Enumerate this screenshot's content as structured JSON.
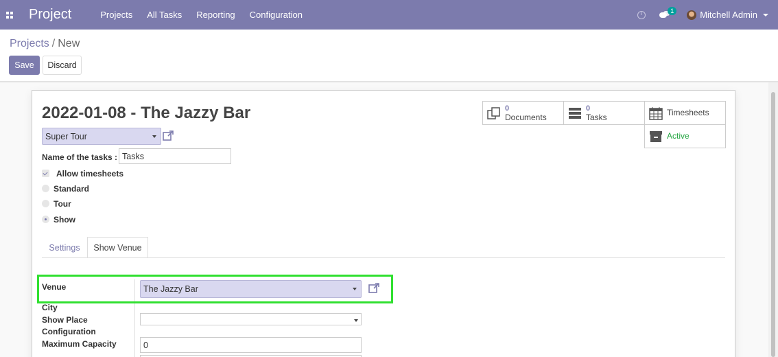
{
  "navbar": {
    "app_name": "Project",
    "menu": [
      "Projects",
      "All Tasks",
      "Reporting",
      "Configuration"
    ],
    "messages_count": "1",
    "user_name": "Mitchell Admin"
  },
  "breadcrumb": {
    "parent": "Projects",
    "separator": "/",
    "current": "New"
  },
  "actions": {
    "save": "Save",
    "discard": "Discard"
  },
  "record": {
    "title": "2022-01-08 - The Jazzy Bar",
    "stage": "Super Tour",
    "name_of_tasks_label": "Name of the tasks :",
    "name_of_tasks_value": "Tasks",
    "allow_timesheets_label": "Allow timesheets",
    "radio_options": [
      "Standard",
      "Tour",
      "Show"
    ],
    "selected_option": "Show"
  },
  "smart_buttons": {
    "documents_count": "0",
    "documents_label": "Documents",
    "tasks_count": "0",
    "tasks_label": "Tasks",
    "timesheets_label": "Timesheets",
    "active_label": "Active"
  },
  "tabs": [
    "Settings",
    "Show Venue"
  ],
  "active_tab": "Show Venue",
  "venue_section": {
    "venue_label": "Venue",
    "venue_value": "The Jazzy Bar",
    "city_label": "City",
    "show_place_label": "Show Place",
    "configuration_label": "Configuration",
    "show_place_value": "",
    "max_capacity_label": "Maximum Capacity",
    "max_capacity_value": "0"
  },
  "colors": {
    "brand": "#7c7bad",
    "active_status": "#28a745",
    "highlight_border": "#30e030"
  }
}
